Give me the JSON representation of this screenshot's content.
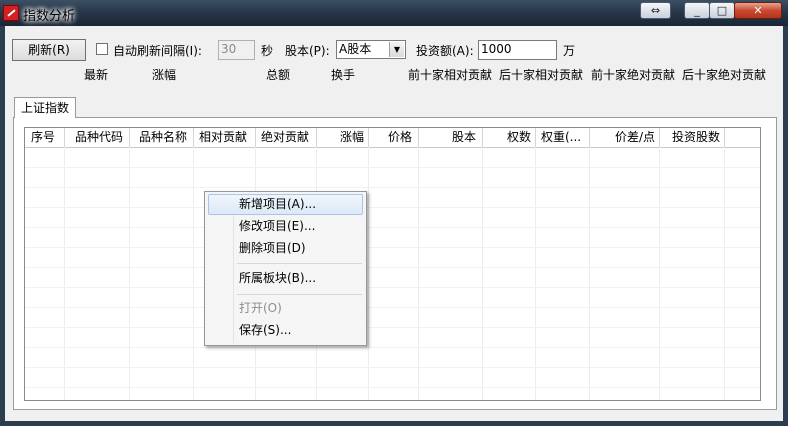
{
  "window": {
    "title": "指数分析",
    "restore_glyph": "⇔",
    "minimize_glyph": "_",
    "maximize_glyph": "□",
    "close_glyph": "✕"
  },
  "toolbar": {
    "refresh_label": "刷新(R)",
    "auto_refresh_label": "自动刷新间隔(I):",
    "auto_refresh_checked": false,
    "interval_value": "30",
    "seconds_label": "秒",
    "share_capital_label": "股本(P):",
    "share_capital_value": "A股本",
    "investment_label": "投资额(A):",
    "investment_value": "1000",
    "unit_label": "万"
  },
  "summary_labels": [
    "最新",
    "涨幅",
    "总额",
    "换手",
    "前十家相对贡献",
    "后十家相对贡献",
    "前十家绝对贡献",
    "后十家绝对贡献"
  ],
  "tabs": [
    {
      "label": "上证指数"
    }
  ],
  "table": {
    "columns": [
      "序号",
      "品种代码",
      "品种名称",
      "相对贡献",
      "绝对贡献",
      "涨幅",
      "价格",
      "股本",
      "权数",
      "权重(...",
      "价差/点",
      "投资股数"
    ],
    "rows": []
  },
  "context_menu": {
    "items": [
      {
        "label": "新增项目(A)...",
        "enabled": true,
        "highlighted": true
      },
      {
        "label": "修改项目(E)...",
        "enabled": true
      },
      {
        "label": "删除项目(D)",
        "enabled": true
      },
      {
        "separator": true
      },
      {
        "label": "所属板块(B)...",
        "enabled": true
      },
      {
        "separator": true
      },
      {
        "label": "打开(O)",
        "enabled": false
      },
      {
        "label": "保存(S)...",
        "enabled": true
      }
    ]
  }
}
